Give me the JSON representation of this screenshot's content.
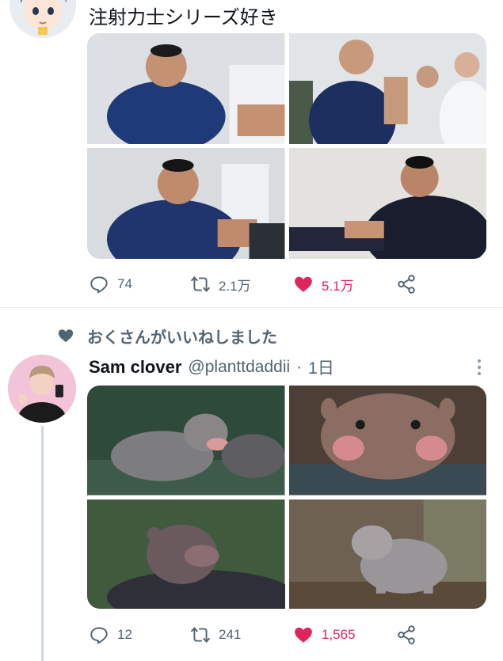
{
  "tweet1": {
    "text": "注射力士シリーズ好き",
    "images": [
      "sumo wrestler grimacing in navy robe",
      "sumo wrestler receiving injection from doctor",
      "sumo wrestler crying out while injected",
      "sumo wrestler holding arm during injection"
    ],
    "actions": {
      "replies": "74",
      "retweets": "2.1万",
      "likes": "5.1万"
    },
    "liked": true
  },
  "tweet2": {
    "social_context": "おくさんがいいねしました",
    "display_name": "Sam clover",
    "handle": "@planttdaddii",
    "separator": "·",
    "time": "1日",
    "images": [
      "baby pygmy hippo in water, mouth open",
      "baby pygmy hippo face close-up",
      "baby hippo resting on parent hippo",
      "baby pygmy hippo standing on leaves"
    ],
    "actions": {
      "replies": "12",
      "retweets": "241",
      "likes": "1,565"
    },
    "liked": true
  },
  "colors": {
    "like": "#e0245e",
    "secondary_text": "#536471",
    "primary_text": "#0f1419",
    "divider": "#e6ecf0",
    "thread_line": "#cfd9de"
  },
  "icons": [
    "reply-icon",
    "retweet-icon",
    "heart-icon",
    "share-icon",
    "more-icon"
  ]
}
